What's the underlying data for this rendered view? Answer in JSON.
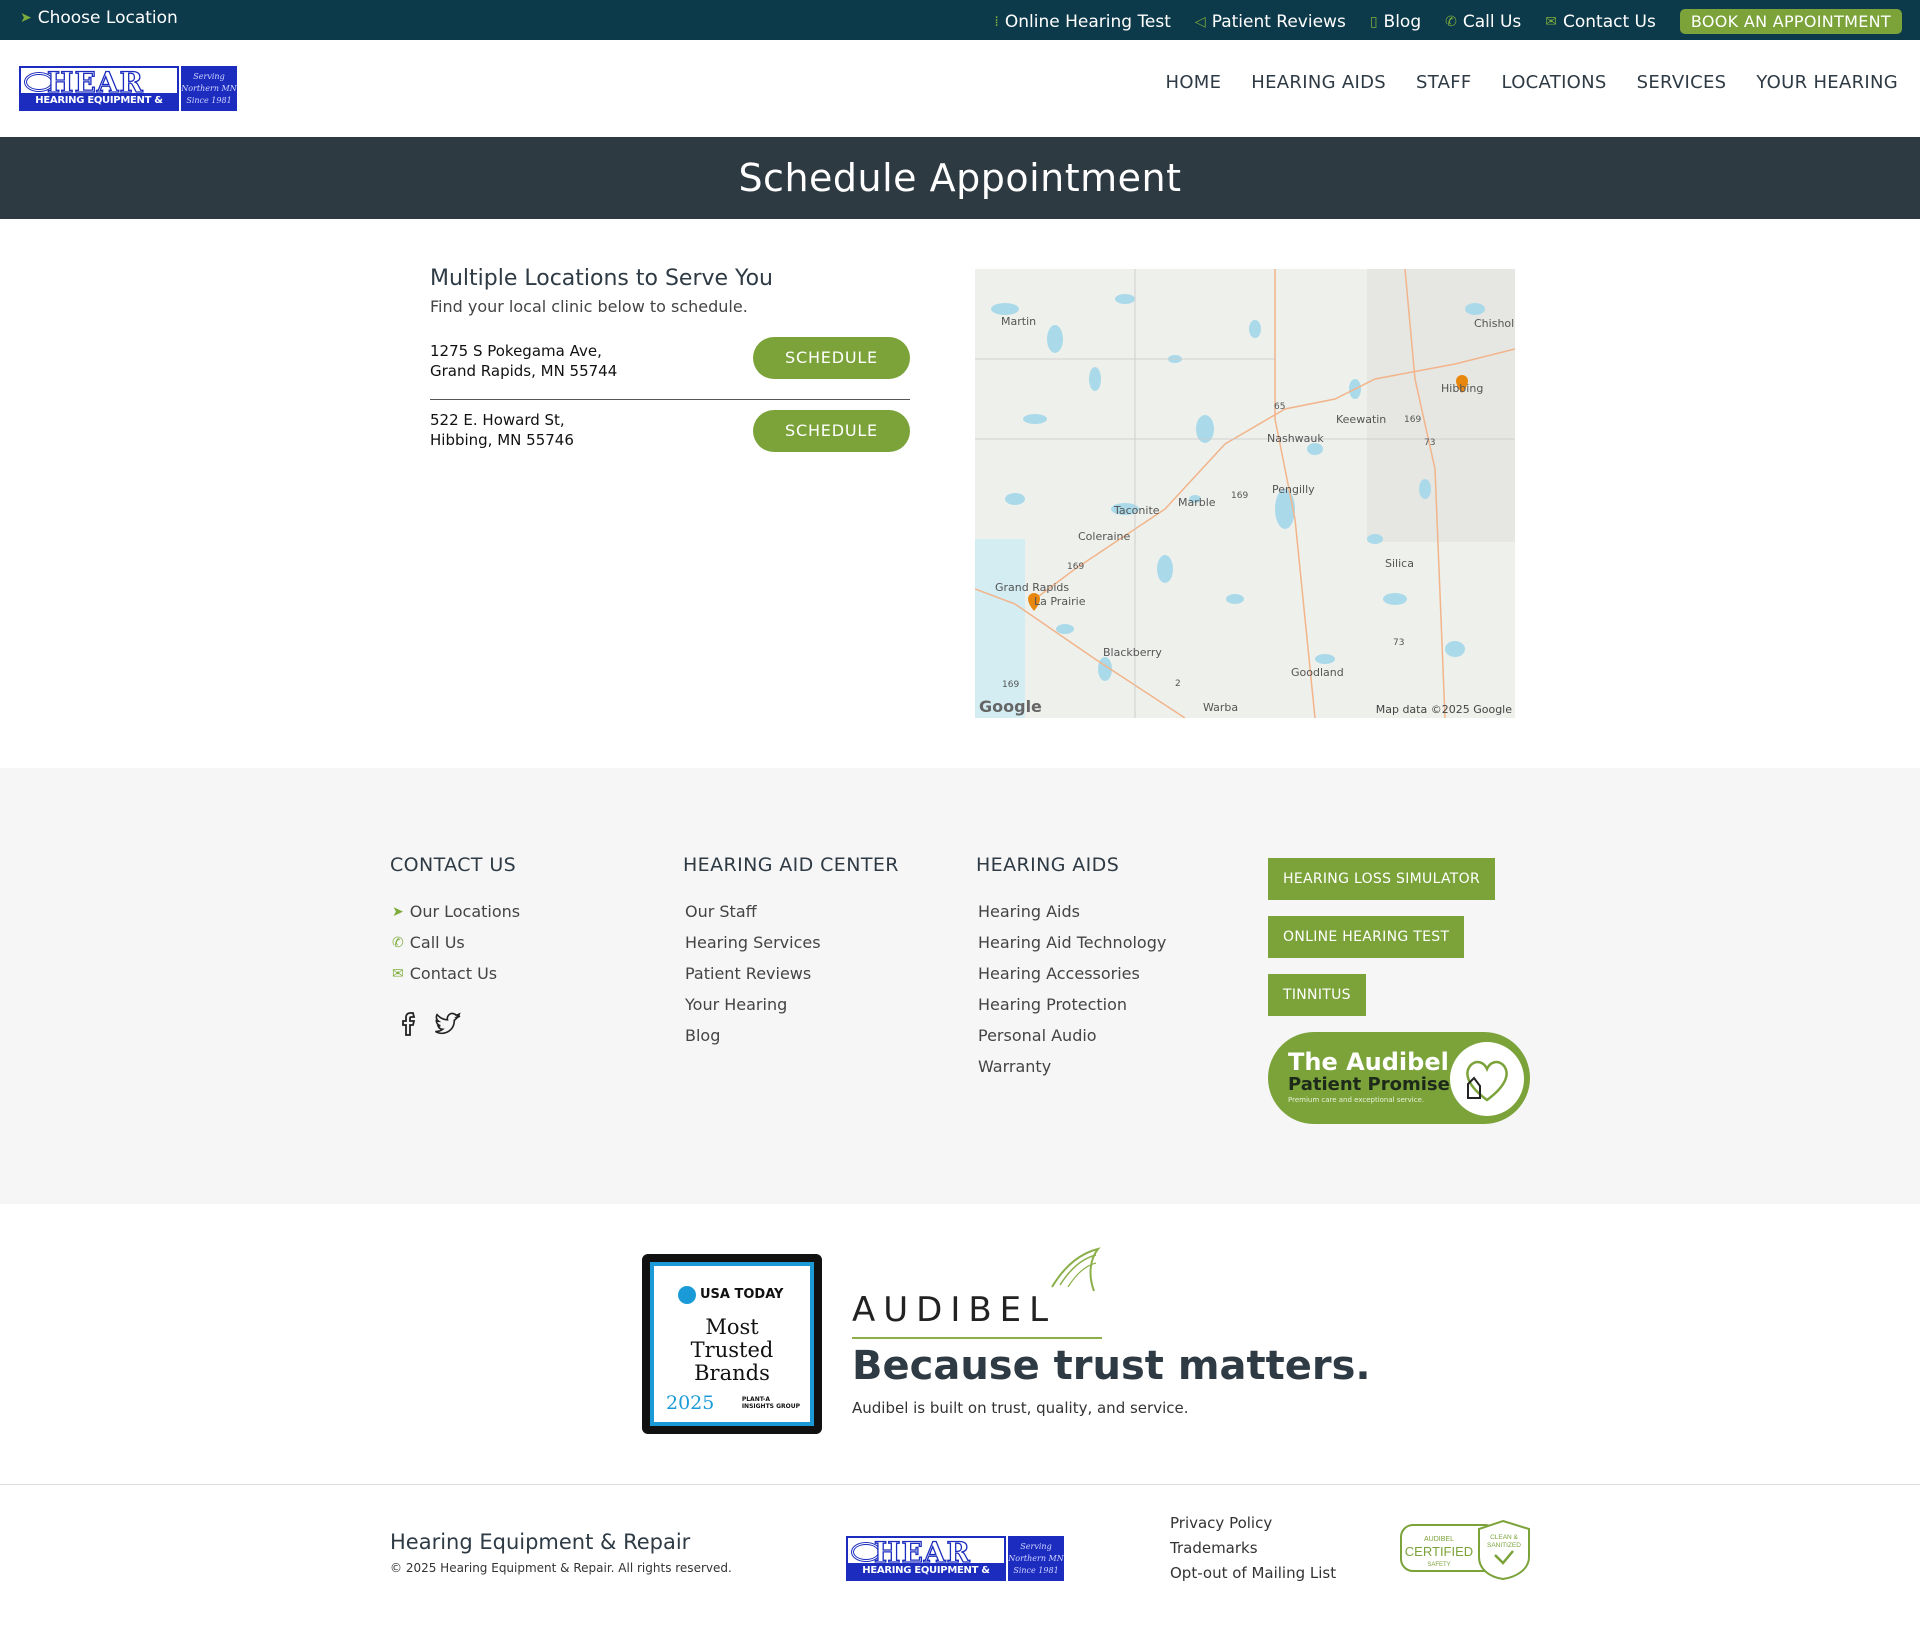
{
  "topbar": {
    "choose_location": "Choose Location",
    "links": [
      {
        "label": "Online Hearing Test",
        "icon": "sound-wave-icon"
      },
      {
        "label": "Patient Reviews",
        "icon": "megaphone-icon"
      },
      {
        "label": "Blog",
        "icon": "document-icon"
      },
      {
        "label": "Call Us",
        "icon": "phone-icon"
      },
      {
        "label": "Contact Us",
        "icon": "envelope-icon"
      }
    ],
    "book_button": "BOOK AN APPOINTMENT"
  },
  "header": {
    "logo": {
      "line1": "HEAR",
      "line2": "HEARING EQUIPMENT & REPAIR",
      "tag": [
        "Serving",
        "Northern MN",
        "Since 1981"
      ]
    },
    "nav": [
      "HOME",
      "HEARING AIDS",
      "STAFF",
      "LOCATIONS",
      "SERVICES",
      "YOUR HEARING"
    ]
  },
  "hero": {
    "title": "Schedule Appointment"
  },
  "main": {
    "heading": "Multiple Locations to Serve You",
    "subheading": "Find your local clinic below to schedule.",
    "locations": [
      {
        "line1": "1275 S Pokegama Ave,",
        "line2": "Grand Rapids, MN 55744",
        "button": "SCHEDULE"
      },
      {
        "line1": "522 E. Howard St,",
        "line2": "Hibbing, MN 55746",
        "button": "SCHEDULE"
      }
    ]
  },
  "map": {
    "places": [
      "Martin",
      "Chisholm",
      "Hibbing",
      "Keewatin",
      "Nashwauk",
      "Pengilly",
      "Marble",
      "Taconite",
      "Coleraine",
      "Silica",
      "Grand Rapids",
      "La Prairie",
      "Blackberry",
      "Goodland",
      "Warba"
    ],
    "route_shields": [
      "65",
      "169",
      "73",
      "169",
      "169",
      "73",
      "2",
      "169"
    ],
    "google_mark": "Google",
    "attribution": "Map data ©2025 Google",
    "marker_color": "#e8870e"
  },
  "footer": {
    "contact": {
      "heading": "CONTACT US",
      "items": [
        {
          "label": "Our Locations",
          "icon": "location-arrow-icon"
        },
        {
          "label": "Call Us",
          "icon": "phone-icon"
        },
        {
          "label": "Contact Us",
          "icon": "envelope-icon"
        }
      ],
      "social": [
        "facebook-icon",
        "twitter-icon"
      ]
    },
    "center": {
      "heading": "HEARING AID CENTER",
      "items": [
        "Our Staff",
        "Hearing Services",
        "Patient Reviews",
        "Your Hearing",
        "Blog"
      ]
    },
    "aids": {
      "heading": "HEARING AIDS",
      "items": [
        "Hearing Aids",
        "Hearing Aid Technology",
        "Hearing Accessories",
        "Hearing Protection",
        "Personal Audio",
        "Warranty"
      ]
    },
    "buttons": [
      "HEARING LOSS SIMULATOR",
      "ONLINE HEARING TEST",
      "TINNITUS"
    ],
    "promise": {
      "title": "The Audibel",
      "subtitle": "Patient Promise",
      "tagline": "Premium care and exceptional service."
    }
  },
  "trust": {
    "badge": {
      "brand": "USA TODAY",
      "text": [
        "Most",
        "Trusted",
        "Brands"
      ],
      "year": "2025",
      "partner": [
        "PLANT-A",
        "INSIGHTS GROUP"
      ]
    },
    "audibel": "AUDIBEL",
    "headline": "Because trust matters.",
    "sub": "Audibel is built on trust, quality, and service."
  },
  "bottom": {
    "company": "Hearing Equipment & Repair",
    "copyright": "© 2025 Hearing Equipment & Repair. All rights reserved.",
    "links": [
      "Privacy Policy",
      "Trademarks",
      "Opt-out of Mailing List"
    ],
    "cert": {
      "top": "AUDIBEL",
      "main": "CERTIFIED",
      "bottom": "SAFETY",
      "badge": [
        "CLEAN &",
        "SANITIZED"
      ]
    }
  },
  "colors": {
    "topbar": "#0d3a4a",
    "accent_green": "#7ba33a",
    "hero": "#2e3a42",
    "logo_blue": "#1b2cbf",
    "footer_bg": "#f6f6f6"
  }
}
